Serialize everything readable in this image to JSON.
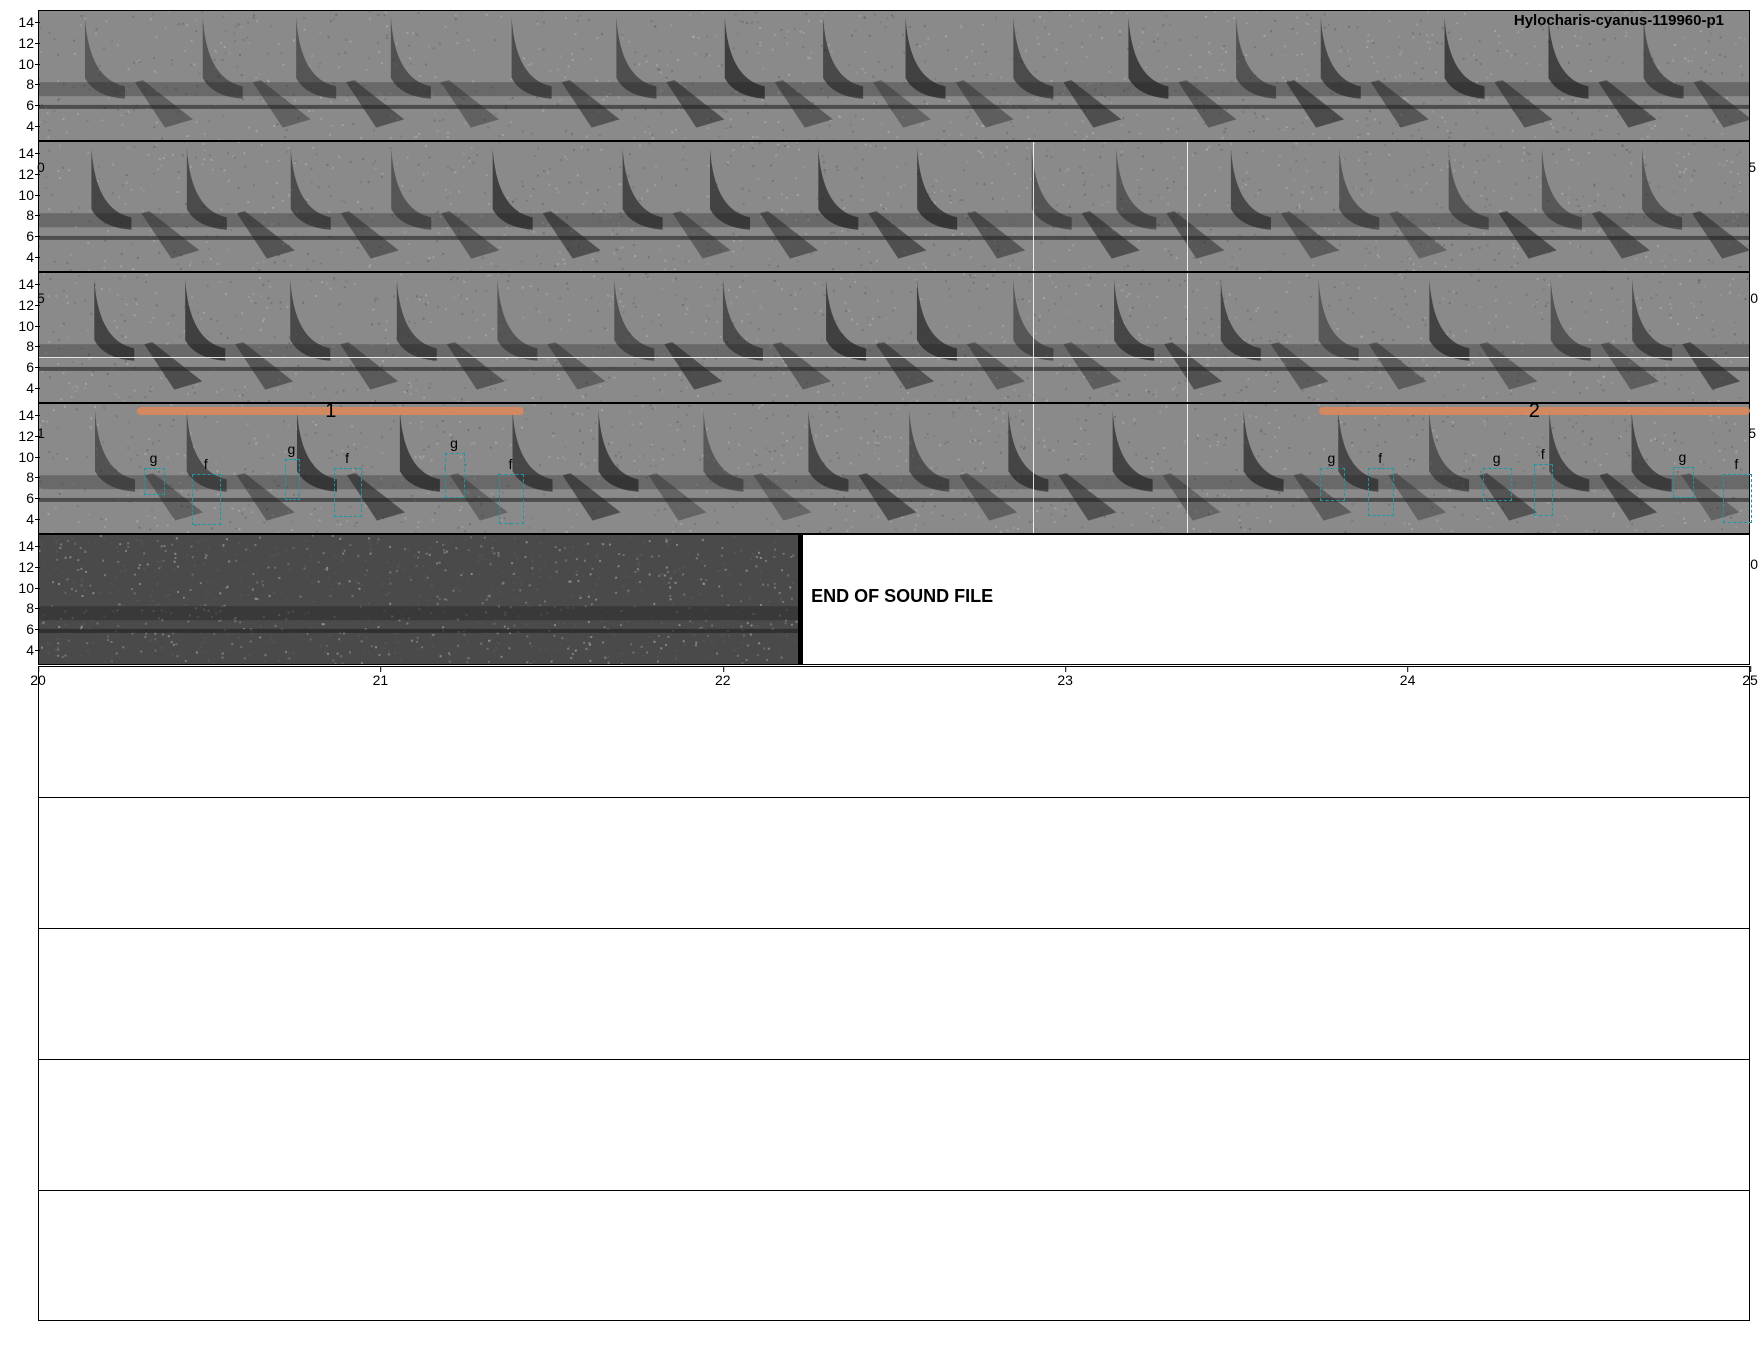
{
  "title": "Hylocharis-cyanus-119960-p1",
  "y_ticks": [
    "14",
    "12",
    "10",
    "8",
    "6",
    "4"
  ],
  "x_ticks": [
    "20",
    "21",
    "22",
    "23",
    "24",
    "25"
  ],
  "end_text": "END OF SOUND FILE",
  "edge_glyphs": {
    "row2_left": "0",
    "row2_right": "5",
    "row3_left": "5",
    "row3_right": "0",
    "row4_left": "1",
    "row4_right": "5",
    "row5_right": "0"
  },
  "phrases": [
    {
      "label": "1",
      "start": 0.058,
      "end": 0.284
    },
    {
      "label": "2",
      "start": 0.748,
      "end": 1.0
    }
  ],
  "notes": [
    {
      "label": "g",
      "t0": 0.062,
      "t1": 0.073,
      "f0": 6.5,
      "f1": 8.9
    },
    {
      "label": "f",
      "t0": 0.09,
      "t1": 0.106,
      "f0": 3.6,
      "f1": 8.3
    },
    {
      "label": "g",
      "t0": 0.144,
      "t1": 0.152,
      "f0": 6.0,
      "f1": 9.8
    },
    {
      "label": "f",
      "t0": 0.173,
      "t1": 0.188,
      "f0": 4.3,
      "f1": 8.9
    },
    {
      "label": "g",
      "t0": 0.238,
      "t1": 0.248,
      "f0": 6.2,
      "f1": 10.4
    },
    {
      "label": "f",
      "t0": 0.269,
      "t1": 0.283,
      "f0": 3.7,
      "f1": 8.3
    },
    {
      "label": "g",
      "t0": 0.749,
      "t1": 0.762,
      "f0": 5.9,
      "f1": 8.9
    },
    {
      "label": "f",
      "t0": 0.777,
      "t1": 0.791,
      "f0": 4.4,
      "f1": 8.9
    },
    {
      "label": "g",
      "t0": 0.844,
      "t1": 0.86,
      "f0": 5.9,
      "f1": 8.9
    },
    {
      "label": "f",
      "t0": 0.874,
      "t1": 0.884,
      "f0": 4.4,
      "f1": 9.3
    },
    {
      "label": "g",
      "t0": 0.955,
      "t1": 0.966,
      "f0": 6.2,
      "f1": 9.0
    },
    {
      "label": "f",
      "t0": 0.984,
      "t1": 1.0,
      "f0": 3.8,
      "f1": 8.3
    }
  ],
  "colors": {
    "phrase": "#d9885a",
    "note_box": "#1a9aa8",
    "spec_bg": "#8a8a8a"
  },
  "spectrogram_rows": [
    {
      "id": "row1",
      "vlines": []
    },
    {
      "id": "row2",
      "vlines": [
        0.581,
        0.671
      ]
    },
    {
      "id": "row3",
      "vlines": [
        0.581,
        0.671
      ],
      "hline_khz": 7
    },
    {
      "id": "row4",
      "vlines": [
        0.581,
        0.671
      ]
    },
    {
      "id": "row5",
      "vlines": [],
      "end_frac": 0.444
    }
  ]
}
